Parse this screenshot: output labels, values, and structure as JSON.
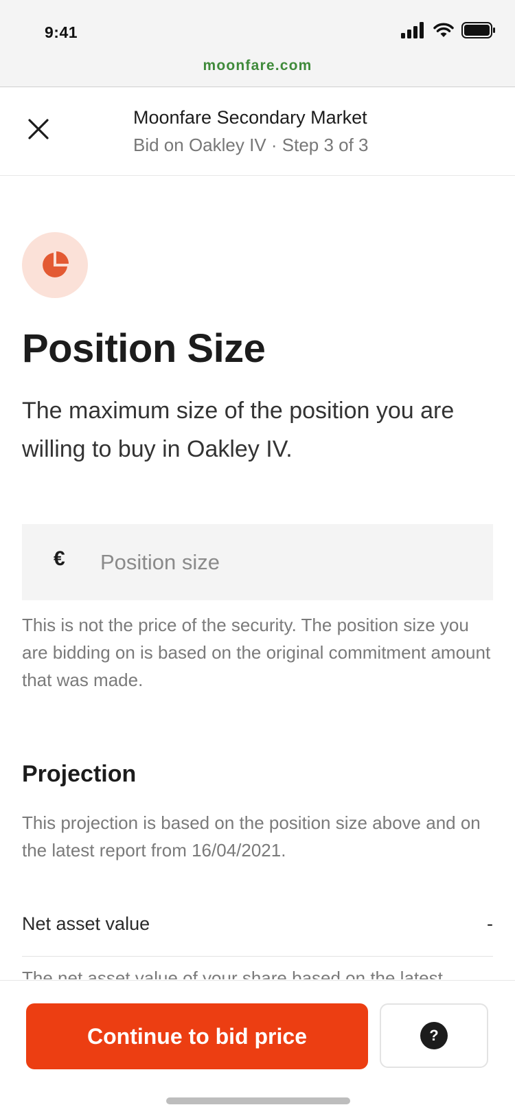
{
  "status_bar": {
    "time": "9:41",
    "icons": [
      "signal-icon",
      "wifi-icon",
      "battery-icon"
    ]
  },
  "browser": {
    "url": "moonfare.com",
    "url_color": "#3f8a3a"
  },
  "header": {
    "title": "Moonfare Secondary Market",
    "subtitle": "Bid on Oakley IV · Step 3 of 3",
    "close_icon": "close-icon"
  },
  "main": {
    "icon": "pie-chart-icon",
    "title": "Position Size",
    "lead": "The maximum size of the position you are willing to buy in Oakley IV.",
    "input": {
      "currency": "€",
      "placeholder": "Position size",
      "value": ""
    },
    "help_text": "This is not the price of the security. The position size you are bidding on is based on the original commitment amount that was made."
  },
  "projection": {
    "title": "Projection",
    "description": "This projection is based on the position size above and on the latest report from 16/04/2021.",
    "rows": [
      {
        "label": "Net asset value",
        "value": "-"
      }
    ],
    "clipped_text": "The net asset value of your share based on the latest"
  },
  "footer": {
    "primary_label": "Continue to bid price",
    "help_label": "?",
    "accent": "#ec3e12"
  }
}
